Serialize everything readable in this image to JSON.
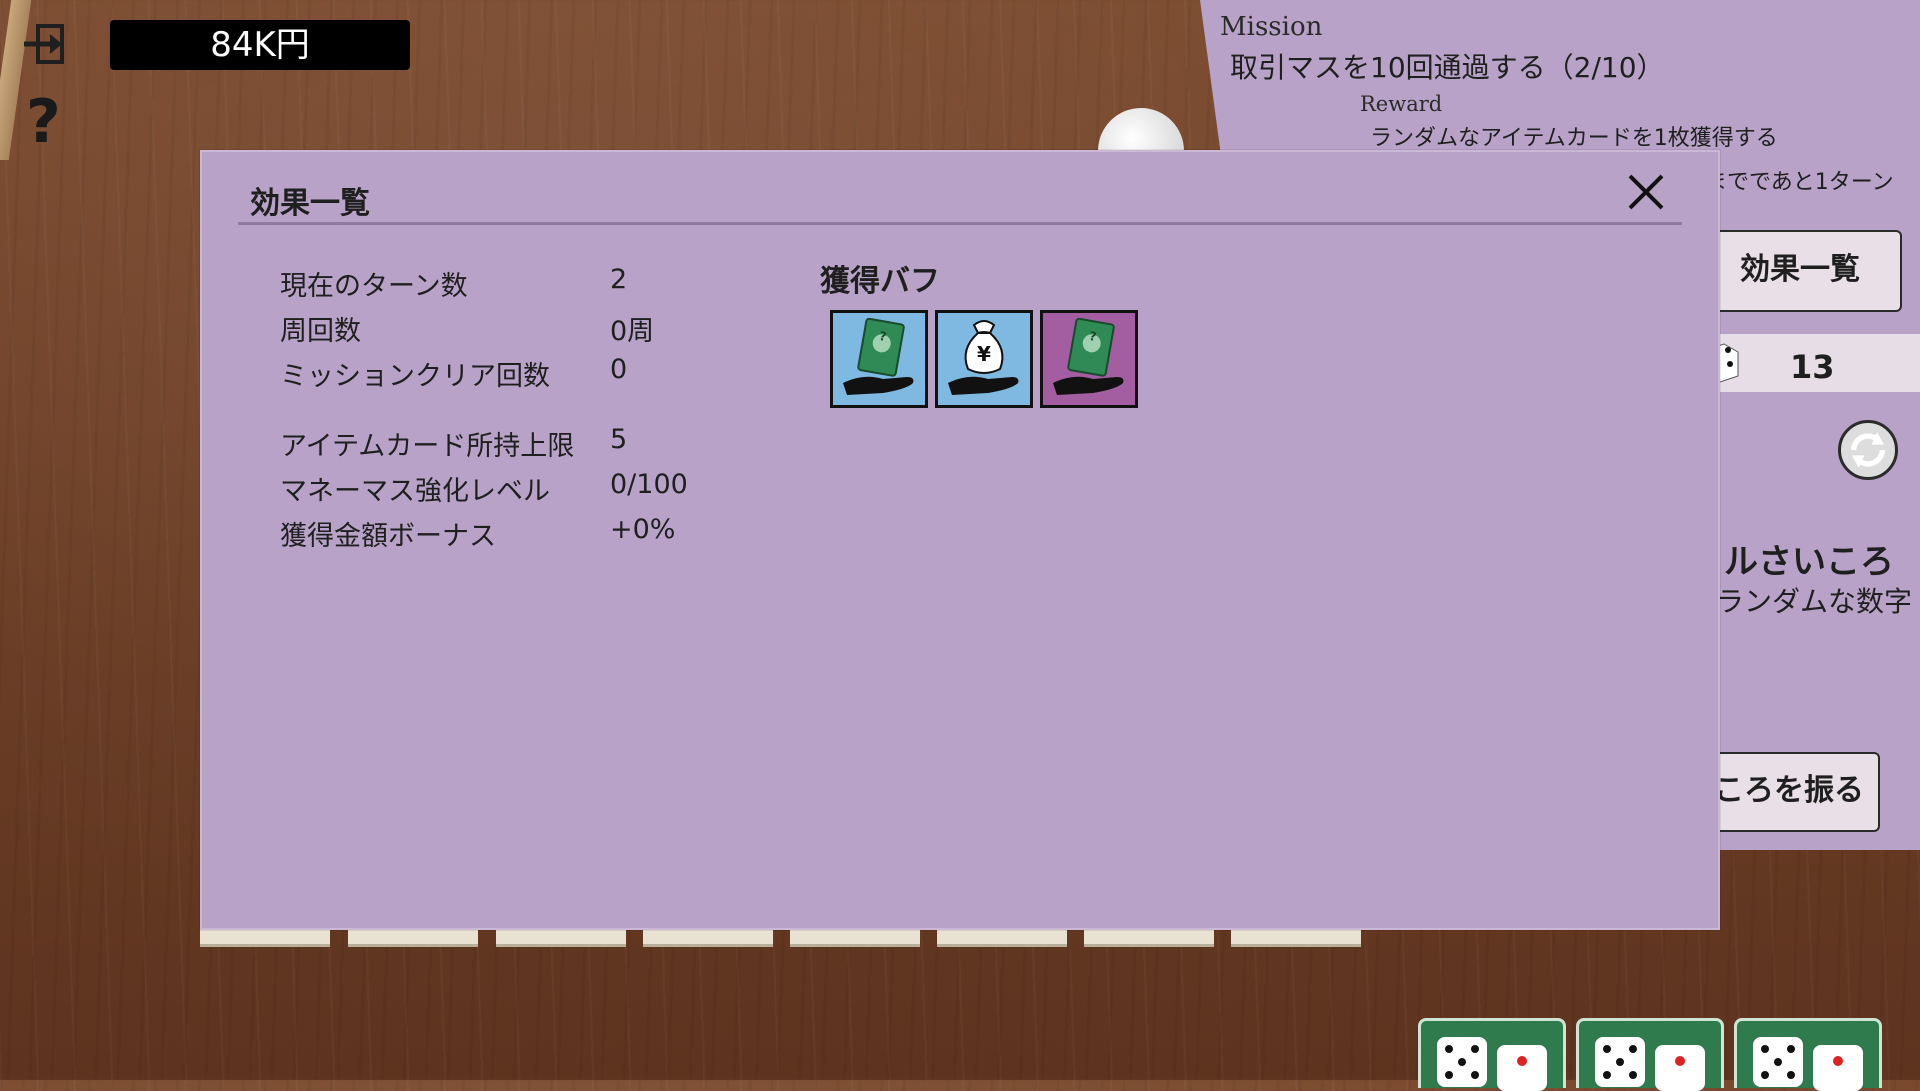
{
  "hud": {
    "money": "84K円",
    "help": "?"
  },
  "mission": {
    "title": "Mission",
    "text": "取引マスを10回通過する（2/10）",
    "reward_title": "Reward",
    "reward_text": "ランダムなアイテムカードを1枚獲得する"
  },
  "side": {
    "turns_left": "までであと1ターン",
    "effects_button": "効果一覧",
    "dice_count": "13",
    "dice_name": "ルさいころ",
    "dice_desc": "ランダムな数字",
    "roll_button": "ころを振る"
  },
  "dialog": {
    "title": "効果一覧",
    "stats_group1": [
      {
        "label": "現在のターン数",
        "value": "2"
      },
      {
        "label": "周回数",
        "value": "0周"
      },
      {
        "label": "ミッションクリア回数",
        "value": "0"
      }
    ],
    "stats_group2": [
      {
        "label": "アイテムカード所持上限",
        "value": "5"
      },
      {
        "label": "マネーマス強化レベル",
        "value": "0/100"
      },
      {
        "label": "獲得金額ボーナス",
        "value": "+0%"
      }
    ],
    "buff_title": "獲得バフ",
    "buffs": [
      {
        "icon": "card-in-hand-icon",
        "bg": "#7fb9e2"
      },
      {
        "icon": "money-bag-in-hand-icon",
        "bg": "#7fb9e2"
      },
      {
        "icon": "card-in-hand-icon",
        "bg": "#a25ea0"
      }
    ]
  }
}
